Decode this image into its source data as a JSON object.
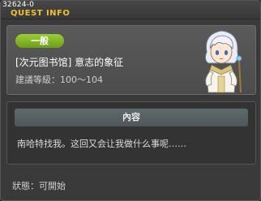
{
  "window": {
    "quest_id": "32624-0",
    "title": "QUEST INFO"
  },
  "quest": {
    "category": "一般",
    "name": "[次元图书馆] 意志的象征",
    "level_requirement": "建議等級：100～104"
  },
  "content": {
    "header": "內容",
    "text": "南哈特找我。这回又会让我做什么事呢……"
  },
  "status": {
    "text": "狀態：可開始"
  },
  "colors": {
    "title": "#f0c030",
    "badge": "#8ab52a",
    "panel": "#555555"
  },
  "icons": [
    "npc-portrait"
  ]
}
